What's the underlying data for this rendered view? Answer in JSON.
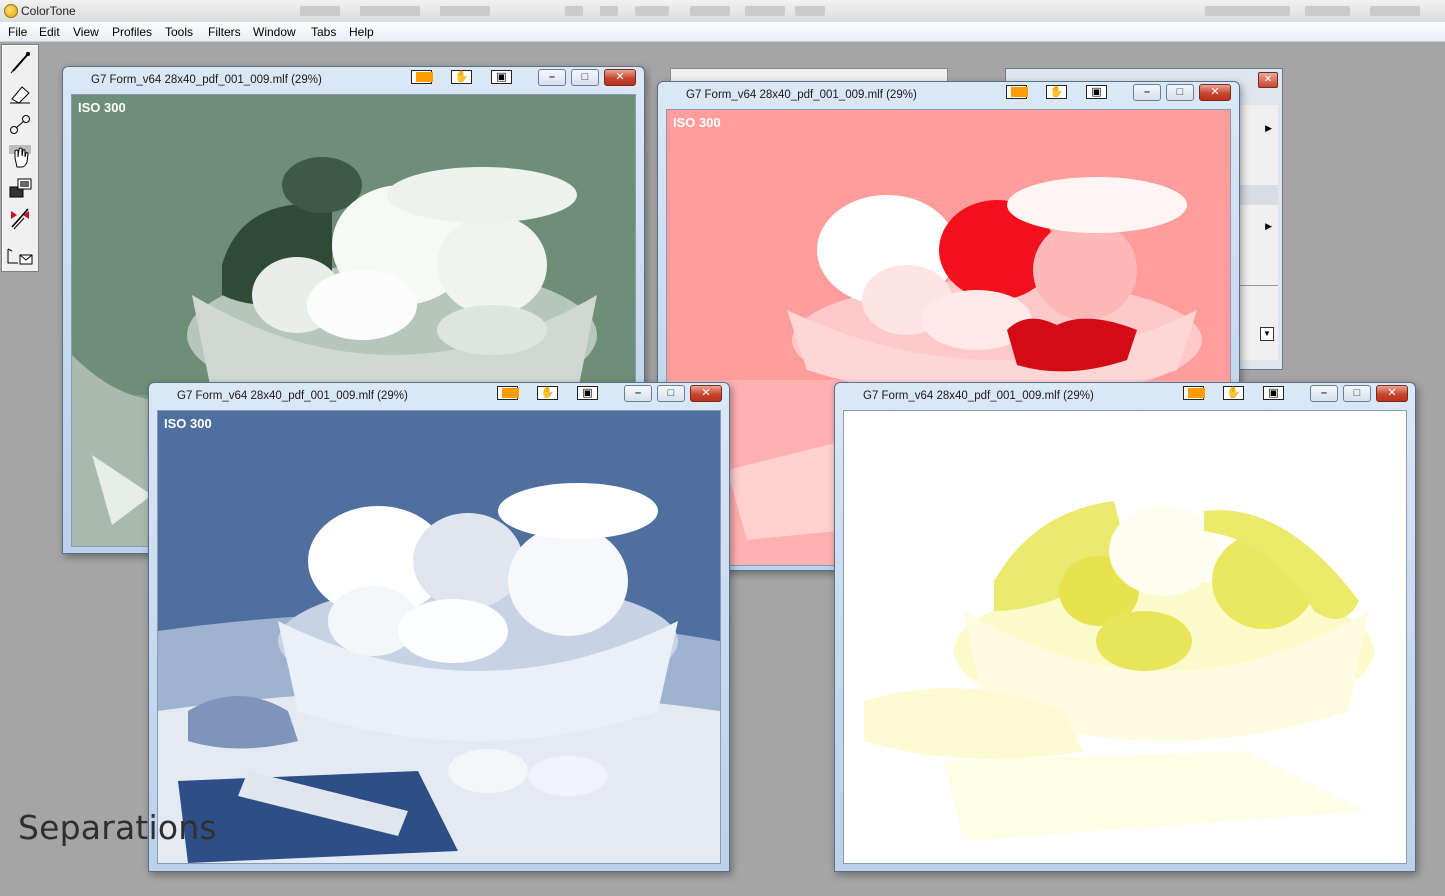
{
  "app": {
    "title": "ColorTone"
  },
  "menu": [
    "File",
    "Edit",
    "View",
    "Profiles",
    "Tools",
    "Filters",
    "Window",
    "Tabs",
    "Help"
  ],
  "windows": [
    {
      "id": "black",
      "title": "G7 Form_v64 28x40_pdf_001_009.mlf (29%)",
      "label": "ISO 300",
      "tint": "#6e8e78"
    },
    {
      "id": "magenta",
      "title": "G7 Form_v64 28x40_pdf_001_009.mlf (29%)",
      "label": "ISO 300",
      "tint": "#ff9c9c"
    },
    {
      "id": "cyan",
      "title": "G7 Form_v64 28x40_pdf_001_009.mlf (29%)",
      "label": "ISO 300",
      "tint": "#4f6f9f"
    },
    {
      "id": "yellow",
      "title": "G7 Form_v64 28x40_pdf_001_009.mlf (29%)",
      "label": "",
      "tint": "#f0ee70"
    }
  ],
  "tools": [
    "eyedropper-icon",
    "eraser-icon",
    "line-nodes-icon",
    "hand-icon",
    "image-swap-icon",
    "no-bug-icon",
    "crop-mail-icon"
  ],
  "caption": "Separations"
}
